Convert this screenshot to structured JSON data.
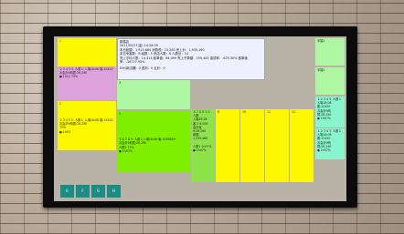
{
  "info": {
    "title": "新橋店",
    "date": "2011/05/27(金) 14:28:59",
    "line1": "本日総額：1,915,880  消費税：23,280  売上計：1,939,160",
    "line2": "本日来客数：8  組数：5  来店人数：6  人数計：14",
    "line3": "売上平均人数：14,314  客単価：64,499  売上予算額：195,400  達成率：-625.30%  客単価",
    "line4": "率：-16727.95%",
    "line5": "DIY(新店舗）0  遅刻：0  合計：0"
  },
  "left_top": {
    "label": "1"
  },
  "pink_pane": {
    "text": "２３４５６  人数１  入場18:06  客:12420\nお会計9時間:26,290\n● 1h11 75%"
  },
  "yellow_left_mid": {
    "label": "2"
  },
  "yellow_left_low": {
    "text": "２３４５６  人数１  入場18:06  客:12420\nお会計9時間:26,290\n75%\n● 1h53"
  },
  "green_light": {
    "label": "3"
  },
  "green_big": {
    "label": "5",
    "text": "５６７８９  人数１入場18:06  客:1036829\nお会計9時間:26,290\n人数5  75%\n● 1h07%"
  },
  "green_narrow": {
    "text": "６７８９１０  人数\n入場19:28\n客:1 9,000\n会計後9:26,290\n総額1,295,480\n\n人数1  1h07%\n● 1h07%"
  },
  "yellow_cells": [
    {
      "label": "8"
    },
    {
      "label": "10"
    },
    {
      "label": "11"
    },
    {
      "label": "12"
    }
  ],
  "right_top": {
    "label": "半端1"
  },
  "right_mid": {
    "label": "半端2"
  },
  "right_low1": {
    "text": "１２３４５  人数１  入場18:06  客:12420\nお会計9時間:26,290\n● 1h07%"
  },
  "right_low2": {
    "text": "１２３４５  人数１  入場18:06  客:12420\nお会計9時間:26,290\n● 1h07%"
  },
  "buttons": [
    {
      "label": "E"
    },
    {
      "label": "F"
    },
    {
      "label": "G"
    },
    {
      "label": "H"
    }
  ]
}
